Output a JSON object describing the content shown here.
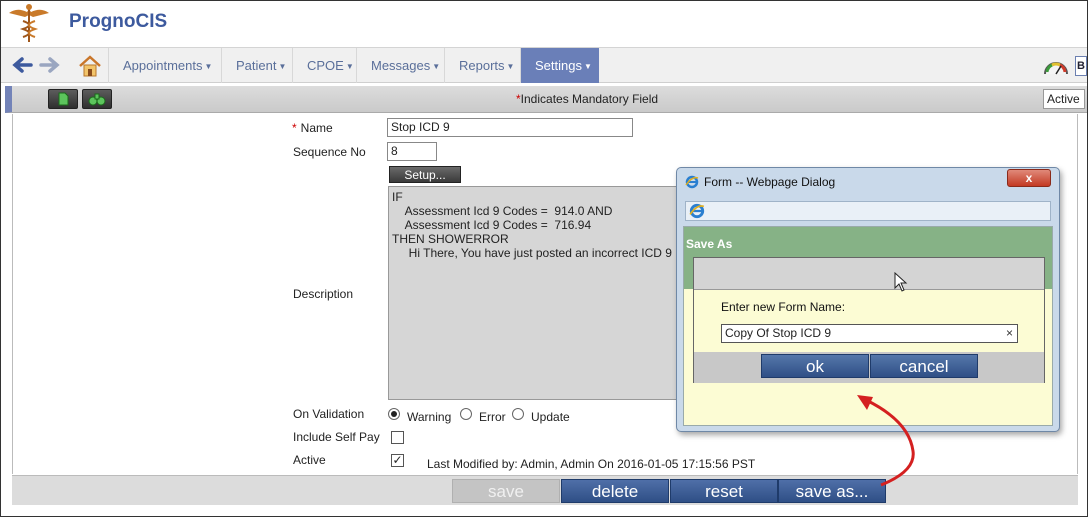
{
  "app": {
    "title": "PrognoCIS"
  },
  "nav": {
    "menus": [
      {
        "label": "Appointments"
      },
      {
        "label": "Patient"
      },
      {
        "label": "CPOE"
      },
      {
        "label": "Messages"
      },
      {
        "label": "Reports"
      },
      {
        "label": "Settings"
      }
    ],
    "active_menu": "Settings",
    "caret_icon": "triangle-down-icon",
    "right_badge": "B"
  },
  "toolbar": {
    "mandatory_marker": "*",
    "mandatory_text": "Indicates Mandatory Field",
    "status_value": "Active"
  },
  "form": {
    "name_label": "Name",
    "name_required_marker": "*",
    "name_value": "Stop ICD 9",
    "sequence_label": "Sequence No",
    "sequence_value": "8",
    "setup_button": "Setup...",
    "description_label": "Description",
    "description_text": "IF\n    Assessment Icd 9 Codes =  914.0 AND\n    Assessment Icd 9 Codes =  716.94\nTHEN SHOWERROR\n     Hi There, You have just posted an incorrect ICD 9",
    "on_validation_label": "On Validation",
    "validation_options": [
      {
        "label": "Warning",
        "selected": true
      },
      {
        "label": "Error",
        "selected": false
      },
      {
        "label": "Update",
        "selected": false
      }
    ],
    "include_self_pay_label": "Include Self Pay",
    "include_self_pay_checked": false,
    "active_label": "Active",
    "active_checked": true,
    "check_mark": "✓",
    "last_modified": "Last Modified by: Admin, Admin On 2016-01-05 17:15:56 PST"
  },
  "footer": {
    "save_label": "save",
    "delete_label": "delete",
    "reset_label": "reset",
    "save_as_label": "save as..."
  },
  "dialog": {
    "title": "Form -- Webpage Dialog",
    "close_glyph": "x",
    "section_title": "Save As",
    "prompt_label": "Enter new Form Name:",
    "name_value": "Copy Of Stop ICD 9",
    "clear_glyph": "×",
    "ok_label": "ok",
    "cancel_label": "cancel"
  },
  "colors": {
    "brand": "#3d5a9e",
    "active_menu": "#6a7fb8",
    "button": "#2f4f86",
    "dialog_green": "#86b286",
    "annotation_arrow": "#d42020"
  }
}
